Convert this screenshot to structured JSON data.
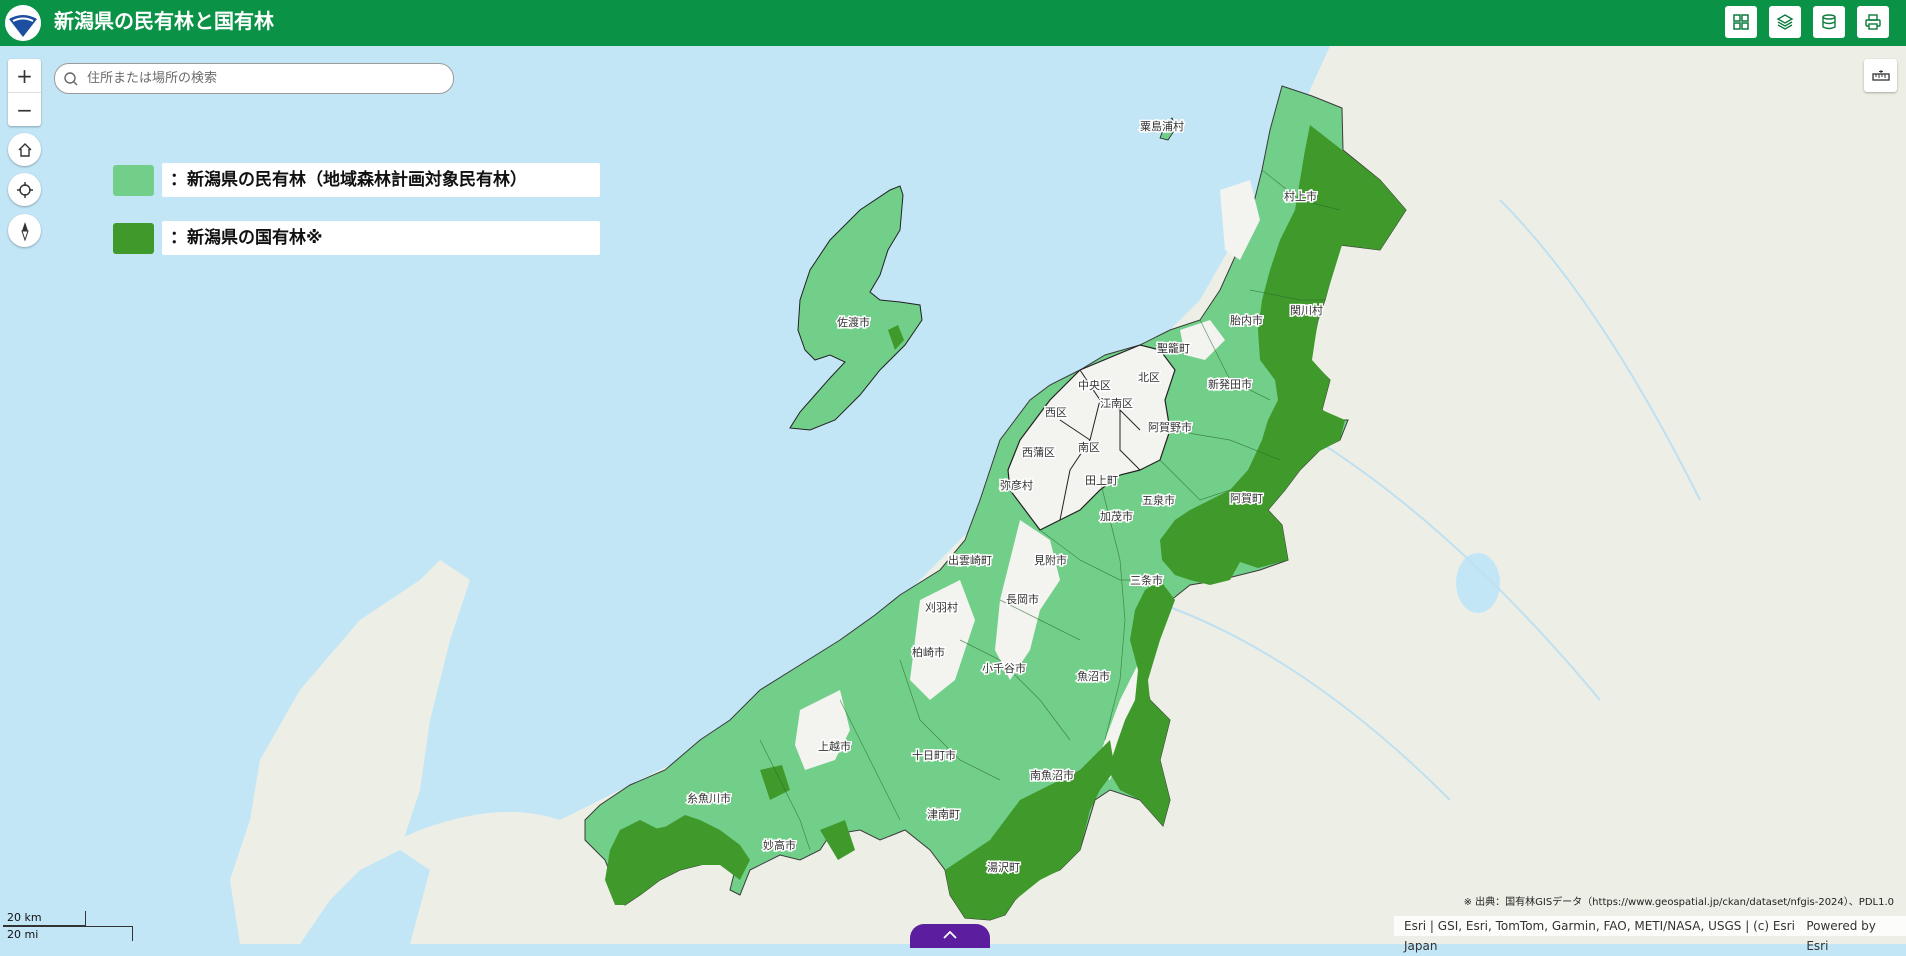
{
  "header": {
    "title": "新潟県の民有林と国有林"
  },
  "toolbar": {
    "buttons": [
      "grid-icon",
      "layers-icon",
      "basemap-icon",
      "print-icon"
    ]
  },
  "map_controls": {
    "zoom_in": "+",
    "zoom_out": "−"
  },
  "search": {
    "placeholder": "住所または場所の検索"
  },
  "legend": {
    "private_forest": {
      "label": "：新潟県の民有林（地域森林計画対象民有林）",
      "color": "#72cf89"
    },
    "national_forest": {
      "label": "：新潟県の国有林※",
      "color": "#3f9a2b"
    }
  },
  "places": {
    "awashimaura": "粟島浦村",
    "sado": "佐渡市",
    "murakami": "村上市",
    "sekikawa": "関川村",
    "tainai": "胎内市",
    "seiro": "聖籠町",
    "kita": "北区",
    "shibata": "新発田市",
    "chuo": "中央区",
    "konan": "江南区",
    "nishi": "西区",
    "agano": "阿賀野市",
    "minami": "南区",
    "nishikan": "西蒲区",
    "yahiko": "弥彦村",
    "tagami": "田上町",
    "gosen": "五泉市",
    "aga": "阿賀町",
    "kamo": "加茂市",
    "izumozaki": "出雲崎町",
    "mitsuke": "見附市",
    "sanjo": "三条市",
    "kariwa": "刈羽村",
    "nagaoka": "長岡市",
    "kashiwazaki": "柏崎市",
    "ojiya": "小千谷市",
    "uonuma": "魚沼市",
    "joetsu": "上越市",
    "tokamachi": "十日町市",
    "minamiuonuma": "南魚沼市",
    "itoigawa": "糸魚川市",
    "tsunan": "津南町",
    "myoko": "妙高市",
    "yuzawa": "湯沢町"
  },
  "scalebar": {
    "km": "20 km",
    "mi": "20 mi"
  },
  "source_note": "※ 出典：国有林GISデータ（https://www.geospatial.jp/ckan/dataset/nfgis-2024）、PDL1.0",
  "attribution": {
    "text": "Esri | GSI, Esri, TomTom, Garmin, FAO, METI/NASA, USGS | (c) Esri Japan",
    "powered": "Powered by Esri"
  }
}
